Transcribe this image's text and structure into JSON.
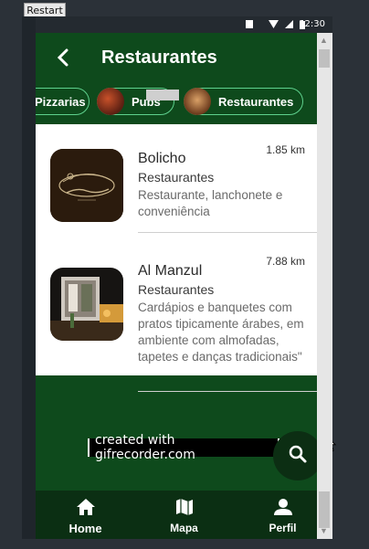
{
  "toolbar": {
    "restart_label": "Restart"
  },
  "status_bar": {
    "time": "12:30"
  },
  "header": {
    "title": "Restaurantes"
  },
  "chips": [
    {
      "label": "Pizzarias"
    },
    {
      "label": "Pubs"
    },
    {
      "label": "Restaurantes"
    }
  ],
  "items": [
    {
      "name": "Bolicho",
      "category": "Restaurantes",
      "description": "Restaurante, lanchonete e conveniência",
      "distance": "1.85 km"
    },
    {
      "name": "Al Manzul",
      "category": "Restaurantes",
      "description": "Cardápios e banquetes com pratos tipicamente árabes, em ambiente com almofadas, tapetes e danças tradicionais\"",
      "distance": "7.88 km"
    }
  ],
  "watermark": "created with gifrecorder.com",
  "nav": [
    {
      "label": "Home"
    },
    {
      "label": "Mapa"
    },
    {
      "label": "Perfil"
    }
  ],
  "colors": {
    "header_bg": "#0e4a1c",
    "chip_border": "#5ed18d",
    "nav_bg": "#0b2f13"
  }
}
